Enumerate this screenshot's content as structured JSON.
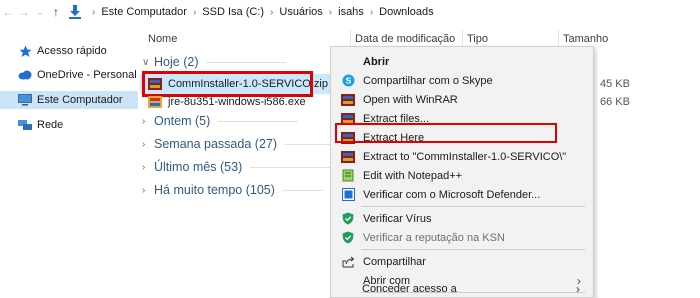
{
  "address": {
    "path": [
      "Este Computador",
      "SSD Isa (C:)",
      "Usuários",
      "isahs",
      "Downloads"
    ]
  },
  "nav": {
    "items": [
      {
        "label": "Acesso rápido",
        "icon": "star-icon"
      },
      {
        "label": "OneDrive - Personal",
        "icon": "cloud-icon"
      },
      {
        "label": "Este Computador",
        "icon": "computer-icon"
      },
      {
        "label": "Rede",
        "icon": "network-icon"
      }
    ]
  },
  "columns": {
    "name": "Nome",
    "date": "Data de modificação",
    "type": "Tipo",
    "size": "Tamanho"
  },
  "groups": {
    "today": {
      "label": "Hoje",
      "count": "(2)"
    },
    "yesterday": {
      "label": "Ontem",
      "count": "(5)"
    },
    "last_week": {
      "label": "Semana passada",
      "count": "(27)"
    },
    "last_month": {
      "label": "Último mês",
      "count": "(53)"
    },
    "long_ago": {
      "label": "Há muito tempo",
      "count": "(105)"
    }
  },
  "files": [
    {
      "name": "CommInstaller-1.0-SERVICO.zip",
      "size": "45 KB"
    },
    {
      "name": "jre-8u351-windows-i586.exe",
      "size": "66 KB"
    }
  ],
  "menu": {
    "open": "Abrir",
    "share_skype": "Compartilhar com o Skype",
    "open_winrar": "Open with WinRAR",
    "extract_files": "Extract files...",
    "extract_here": "Extract Here",
    "extract_to": "Extract to \"CommInstaller-1.0-SERVICO\\\"",
    "edit_notepad": "Edit with Notepad++",
    "defender": "Verificar com o Microsoft Defender...",
    "verify_virus": "Verificar Vírus",
    "verify_ksn": "Verificar a reputação na KSN",
    "share": "Compartilhar",
    "open_with": "Abrir com",
    "grant_access": "Conceder acesso a"
  },
  "colors": {
    "accent": "#e00000",
    "selection": "#cce8ff",
    "nav_selection": "#cce4f7",
    "group_text": "#2e5a8a"
  }
}
